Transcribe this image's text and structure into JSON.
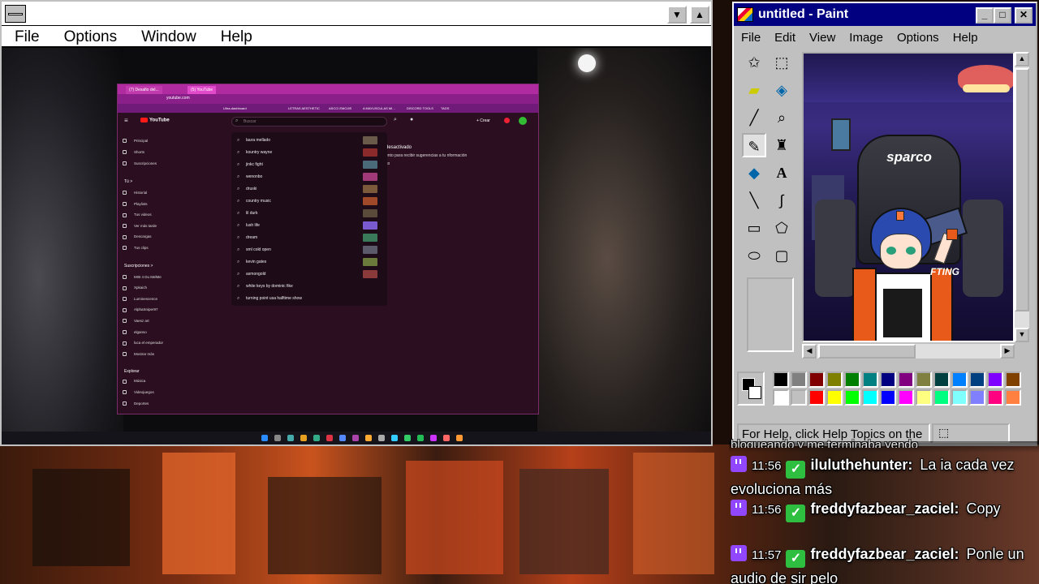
{
  "host": {
    "menu": [
      "File",
      "Options",
      "Window",
      "Help"
    ],
    "min_glyph": "▼",
    "max_glyph": "▲"
  },
  "browser": {
    "tabs": [
      "(7) Desafio del...",
      "(5) YouTube"
    ],
    "url": "youtube.com",
    "bookmarks": [
      "Ultra-dashboard",
      "LETRAS AESTHETIC",
      "ASCCI EMOJIS",
      "A MAYUSCULAS MI...",
      "DISCORD TOOLS",
      "TADS"
    ]
  },
  "youtube": {
    "logo": "YouTube",
    "search_placeholder": "Buscar",
    "create_label": "+ Crear",
    "notice_title": "desactivado",
    "notice_body": "ento para recibir sugerencias a tu nformación",
    "notice_extra": "so",
    "sidebar": {
      "main": [
        "Principal",
        "Shorts",
        "Suscripciones"
      ],
      "you_header": "Tú >",
      "you": [
        "Historial",
        "Playlists",
        "Tus videos",
        "Ver más tarde",
        "Descargas",
        "Tus clips"
      ],
      "subs_header": "Suscripciones >",
      "subs": [
        "MrB 4 Du MelMe",
        "Xpkaich",
        "Luminescence",
        "AlphaSniper97",
        "Vaesz art",
        "elganso",
        "luca el emperador",
        "Mostrar más"
      ],
      "explore_header": "Explorar",
      "explore": [
        "Música",
        "Videojuegos",
        "Deportes"
      ]
    },
    "suggestions": [
      {
        "text": "laura mellado",
        "thumb": "#6a5a4a"
      },
      {
        "text": "kountry wayne",
        "thumb": "#8a2a2a"
      },
      {
        "text": "jinkc fight",
        "thumb": "#4a6a7a"
      },
      {
        "text": "wenonbo",
        "thumb": "#a23a7a"
      },
      {
        "text": "druski",
        "thumb": "#7a5a3a"
      },
      {
        "text": "country music",
        "thumb": "#a04a2a"
      },
      {
        "text": "lil durk",
        "thumb": "#5a4a3a"
      },
      {
        "text": "lush life",
        "thumb": "#7a5ad0"
      },
      {
        "text": "dream",
        "thumb": "#3a7a5a"
      },
      {
        "text": "sml cold open",
        "thumb": "#5a5a6a"
      },
      {
        "text": "kevin gates",
        "thumb": "#6a7a3a"
      },
      {
        "text": "asmongold",
        "thumb": "#8a3a3a"
      },
      {
        "text": "white keys by dominic fike",
        "thumb": ""
      },
      {
        "text": "turning point usa halftime show",
        "thumb": ""
      }
    ]
  },
  "paint": {
    "title": "untitled - Paint",
    "menu": [
      "File",
      "Edit",
      "View",
      "Image",
      "Options",
      "Help"
    ],
    "status": "For Help, click Help Topics on the",
    "canvas_label": "sparco",
    "canvas_sub": "FTING",
    "tools": [
      "free-select",
      "rect-select",
      "eraser",
      "fill",
      "picker",
      "magnifier",
      "pencil",
      "brush",
      "airbrush",
      "text",
      "line",
      "curve",
      "rectangle",
      "polygon",
      "ellipse",
      "rounded-rect"
    ],
    "palette_top": [
      "#000000",
      "#808080",
      "#800000",
      "#808000",
      "#008000",
      "#008080",
      "#000080",
      "#800080",
      "#808040",
      "#004040",
      "#0080ff",
      "#004080",
      "#8000ff",
      "#804000"
    ],
    "palette_bottom": [
      "#ffffff",
      "#c0c0c0",
      "#ff0000",
      "#ffff00",
      "#00ff00",
      "#00ffff",
      "#0000ff",
      "#ff00ff",
      "#ffff80",
      "#00ff80",
      "#80ffff",
      "#8080ff",
      "#ff0080",
      "#ff8040"
    ]
  },
  "chat": [
    {
      "time": "11:56",
      "user": "iluluthehunter:",
      "msg": "La ia cada vez evoluciona más"
    },
    {
      "time": "11:56",
      "user": "freddyfazbear_zaciel:",
      "msg": "Copy"
    },
    {
      "time": "11:57",
      "user": "freddyfazbear_zaciel:",
      "msg": "Ponle un audio de sir pelo"
    }
  ],
  "chat_partial": "bloqueando y me terminaba yendo"
}
